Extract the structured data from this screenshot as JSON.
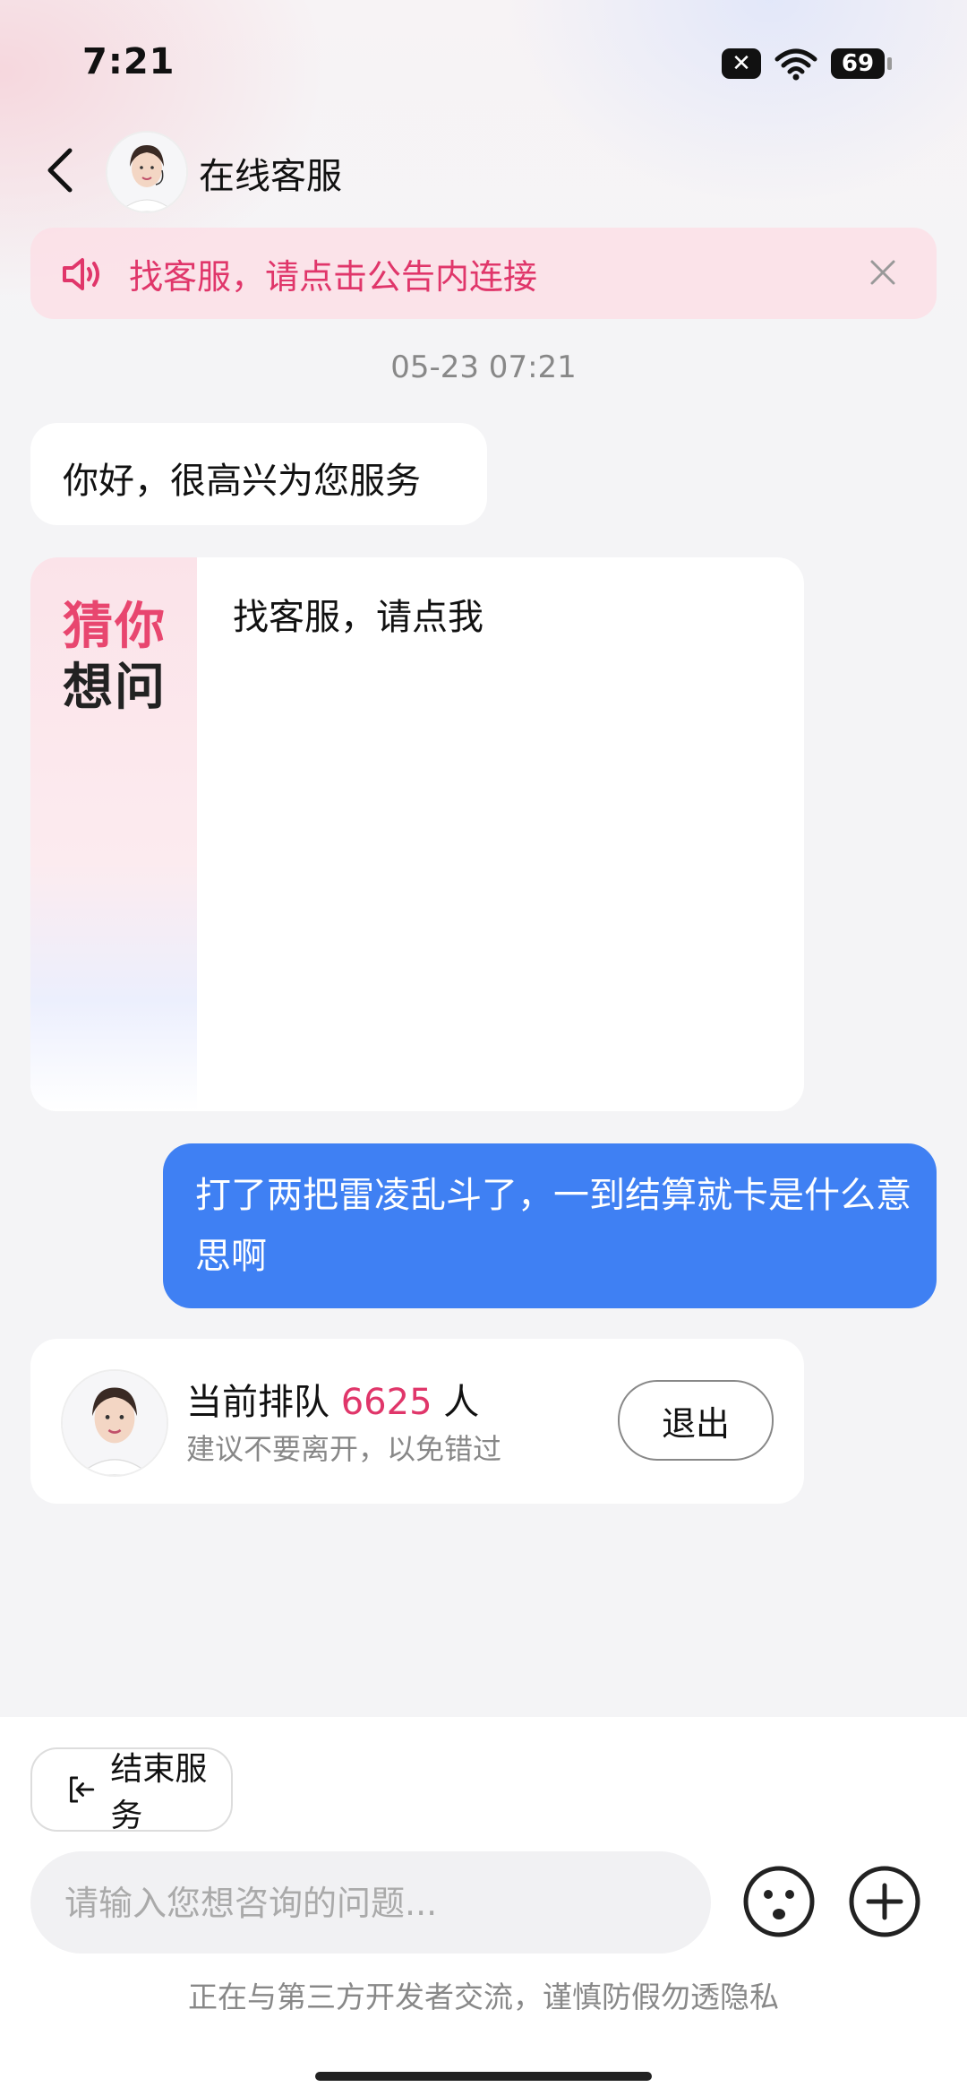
{
  "status_bar": {
    "time": "7:21",
    "battery": "69",
    "icons": [
      "no-sim-icon",
      "wifi-icon",
      "battery-icon"
    ]
  },
  "header": {
    "title": "在线客服",
    "icons": [
      "back-arrow-icon",
      "agent-avatar"
    ]
  },
  "notice": {
    "text": "找客服，请点击公告内连接",
    "icons": [
      "speaker-icon",
      "close-icon"
    ],
    "accent": "#e0366a"
  },
  "chat": {
    "timestamp": "05-23 07:21",
    "greeting": "你好，很高兴为您服务",
    "guess_card": {
      "title_line1": "猜你",
      "title_line2": "想问",
      "items": [
        "找客服，请点我"
      ]
    },
    "user_message": "打了两把雷凌乱斗了，一到结算就卡是什么意思啊",
    "queue": {
      "prefix": "当前排队",
      "count": "6625",
      "suffix": "人",
      "hint": "建议不要离开，以免错过",
      "exit_label": "退出"
    }
  },
  "bottom": {
    "end_service_label": "结束服务",
    "input_placeholder": "请输入您想咨询的问题...",
    "disclaimer": "正在与第三方开发者交流，谨慎防假勿透隐私",
    "icons": [
      "exit-icon",
      "emoji-icon",
      "plus-icon"
    ]
  },
  "colors": {
    "accent_pink": "#e0366a",
    "user_bubble": "#3f80f3"
  }
}
